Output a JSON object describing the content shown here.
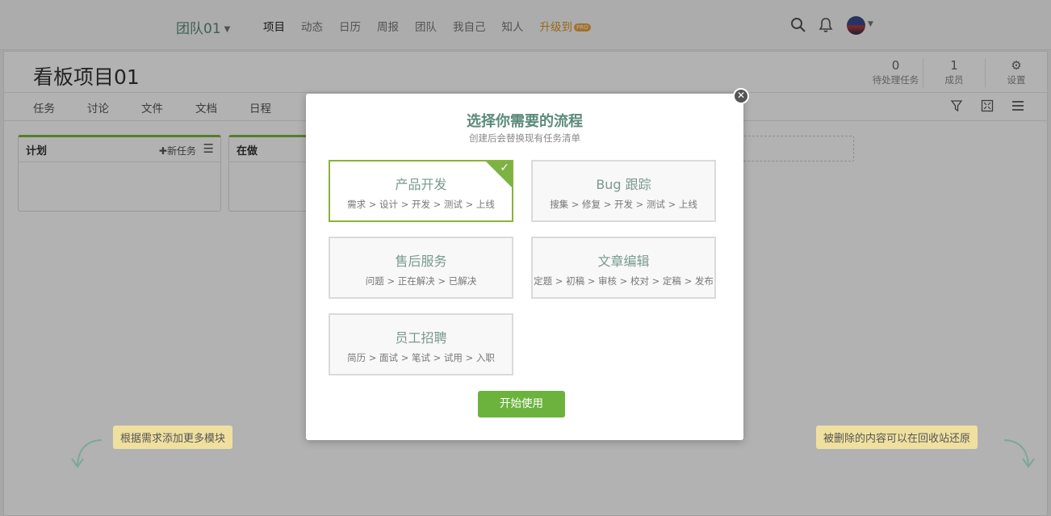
{
  "nav": {
    "team": "团队01",
    "links": [
      "项目",
      "动态",
      "日历",
      "周报",
      "团队",
      "我自己",
      "知人"
    ],
    "upgrade": "升级到",
    "pro_badge": "PRO"
  },
  "project": {
    "title": "看板项目01",
    "stats": [
      {
        "num": "0",
        "label": "待处理任务"
      },
      {
        "num": "1",
        "label": "成员"
      },
      {
        "num": "",
        "label": "设置"
      }
    ],
    "tabs": [
      "任务",
      "讨论",
      "文件",
      "文档",
      "日程"
    ],
    "columns": [
      {
        "name": "计划",
        "add": "新任务"
      },
      {
        "name": "在做"
      }
    ]
  },
  "tips": {
    "left": "根据需求添加更多模块",
    "right": "被删除的内容可以在回收站还原"
  },
  "modal": {
    "title": "选择你需要的流程",
    "subtitle": "创建后会替换现有任务清单",
    "options": [
      {
        "name": "产品开发",
        "steps": "需求 > 设计 > 开发 > 测试 > 上线",
        "selected": true
      },
      {
        "name": "Bug 跟踪",
        "steps": "搜集 > 修复 > 开发 > 测试 > 上线",
        "selected": false
      },
      {
        "name": "售后服务",
        "steps": "问题 > 正在解决 > 已解决",
        "selected": false
      },
      {
        "name": "文章编辑",
        "steps": "定题 > 初稿 > 审核 > 校对 > 定稿 > 发布",
        "selected": false
      },
      {
        "name": "员工招聘",
        "steps": "简历 > 面试 > 笔试 > 试用 > 入职",
        "selected": false
      }
    ],
    "start_label": "开始使用"
  },
  "colors": {
    "accent": "#6cb33e",
    "title": "#5b8a7a",
    "tip_bg": "#efe0a0"
  }
}
